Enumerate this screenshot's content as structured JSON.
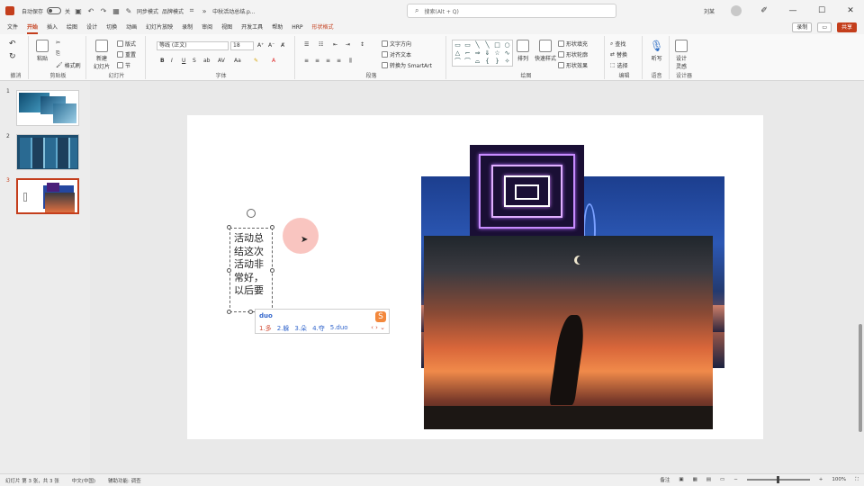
{
  "titlebar": {
    "autosave_label": "自动保存",
    "autosave_state": "关",
    "save_mode": "同步模式",
    "brand_mode": "品牌模式",
    "file_name": "中秋活动总结.p...",
    "search_placeholder": "搜索(Alt + Q)",
    "user_name": "刘某"
  },
  "menu": {
    "tabs": [
      "文件",
      "开始",
      "插入",
      "绘图",
      "设计",
      "切换",
      "动画",
      "幻灯片放映",
      "录制",
      "审阅",
      "视图",
      "开发工具",
      "帮助",
      "HRP",
      "形状格式"
    ],
    "active_tab": "开始",
    "record_label": "录制",
    "share_label": "共享"
  },
  "ribbon": {
    "groups": {
      "undo": "撤消",
      "clipboard": "剪贴板",
      "slides": "幻灯片",
      "font": "字体",
      "paragraph": "段落",
      "drawing": "绘图",
      "editing": "编辑",
      "voice": "语音",
      "designer": "设计器"
    },
    "paste_label": "粘贴",
    "format_painter": "格式刷",
    "new_slide": "新建\n幻灯片",
    "layout": "版式",
    "reset": "重置",
    "section": "节",
    "font_name": "等线 (正文)",
    "font_size": "18",
    "text_direction": "文字方向",
    "align_text": "对齐文本",
    "smartart": "转换为 SmartArt",
    "arrange": "排列",
    "quick_styles": "快速样式",
    "shape_fill": "形状填充",
    "shape_outline": "形状轮廓",
    "shape_effects": "形状效果",
    "find": "查找",
    "replace": "替换",
    "select": "选择",
    "dictate": "听写",
    "designer_btn": "设计\n灵感"
  },
  "thumbnails": [
    {
      "num": "1",
      "active": false
    },
    {
      "num": "2",
      "active": false
    },
    {
      "num": "3",
      "active": true
    }
  ],
  "slide": {
    "textbox_text": "活动总结这次活动非常好，以后要",
    "ime": {
      "pinyin": "duo",
      "candidates": [
        "1.多",
        "2.躲",
        "3.朵",
        "4.夺",
        "5.duo"
      ],
      "nav": "‹ › ⌄"
    }
  },
  "statusbar": {
    "slide_info": "幻灯片 第 3 张，共 3 张",
    "language": "中文(中国)",
    "accessibility": "辅助功能: 调查",
    "notes": "备注",
    "zoom": "100%"
  },
  "colors": {
    "accent": "#c43e1c"
  }
}
